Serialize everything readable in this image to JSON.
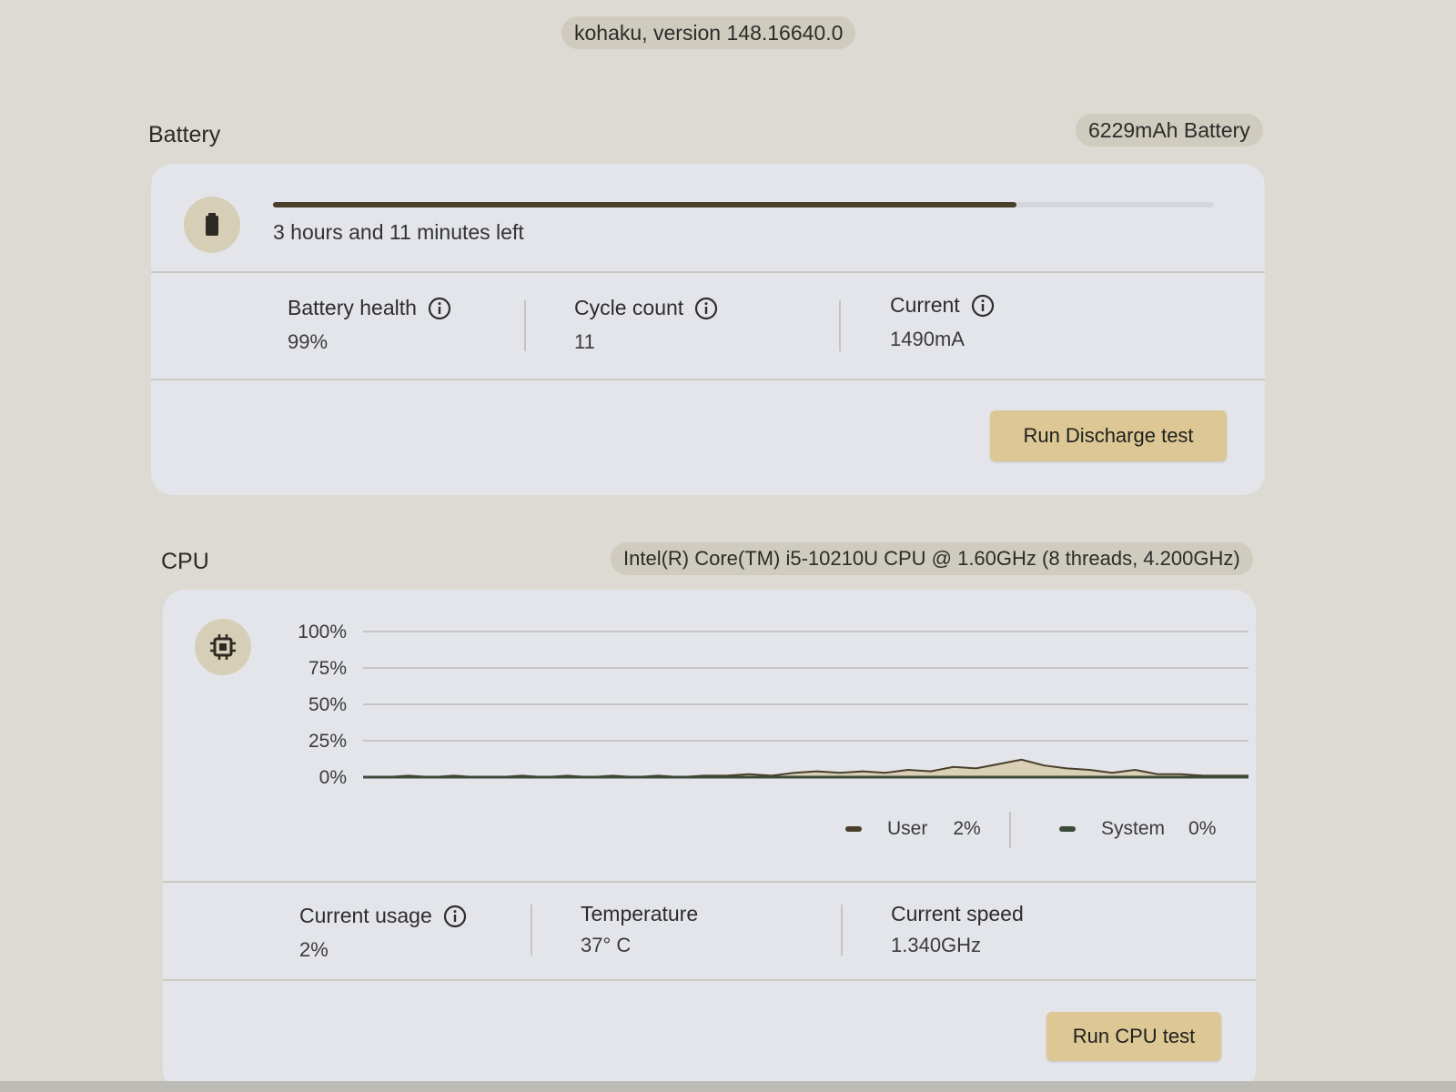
{
  "header": {
    "version_label": "kohaku, version 148.16640.0"
  },
  "battery": {
    "title": "Battery",
    "capacity_badge": "6229mAh Battery",
    "icon": "battery-icon",
    "charge_fraction": 0.79,
    "time_left": "3 hours and 11 minutes left",
    "metrics": [
      {
        "label": "Battery health",
        "value": "99%",
        "has_info": true
      },
      {
        "label": "Cycle count",
        "value": "11",
        "has_info": true
      },
      {
        "label": "Current",
        "value": "1490mA",
        "has_info": true
      }
    ],
    "button_label": "Run Discharge test"
  },
  "cpu": {
    "title": "CPU",
    "model_badge": "Intel(R) Core(TM) i5-10210U CPU @ 1.60GHz (8 threads, 4.200GHz)",
    "icon": "cpu-chip-icon",
    "legend": [
      {
        "label": "User",
        "value": "2%",
        "color": "#4a3f2a"
      },
      {
        "label": "System",
        "value": "0%",
        "color": "#3b4a3a"
      }
    ],
    "metrics": [
      {
        "label": "Current usage",
        "value": "2%",
        "has_info": true
      },
      {
        "label": "Temperature",
        "value": "37° C",
        "has_info": false
      },
      {
        "label": "Current speed",
        "value": "1.340GHz",
        "has_info": false
      }
    ],
    "button_label": "Run CPU test"
  },
  "chart_data": {
    "type": "area",
    "y_tick_labels": [
      "100%",
      "75%",
      "50%",
      "25%",
      "0%"
    ],
    "ylim": [
      0,
      100
    ],
    "grid": true,
    "series": [
      {
        "name": "User",
        "color": "#4a3f2a",
        "values": [
          0,
          0,
          1,
          0,
          1,
          0,
          0,
          1,
          0,
          1,
          0,
          1,
          0,
          1,
          0,
          1,
          1,
          2,
          1,
          3,
          4,
          3,
          4,
          3,
          5,
          4,
          7,
          6,
          9,
          12,
          8,
          6,
          5,
          3,
          5,
          2,
          2,
          1,
          1,
          1
        ]
      },
      {
        "name": "System",
        "color": "#3b4a3a",
        "values": [
          0,
          0,
          0,
          0,
          0,
          0,
          0,
          0,
          0,
          0,
          0,
          0,
          0,
          0,
          0,
          0,
          0,
          0,
          0,
          0,
          0,
          0,
          0,
          0,
          0,
          0,
          0,
          0,
          0,
          0,
          0,
          0,
          0,
          0,
          0,
          0,
          0,
          0,
          0,
          0
        ]
      }
    ]
  },
  "colors": {
    "background": "#dcdad2",
    "card": "#e3e5ea",
    "accent_button": "#dcc795",
    "progress_fill": "#4a3f2a",
    "icon_circle": "#d6ceb6"
  }
}
